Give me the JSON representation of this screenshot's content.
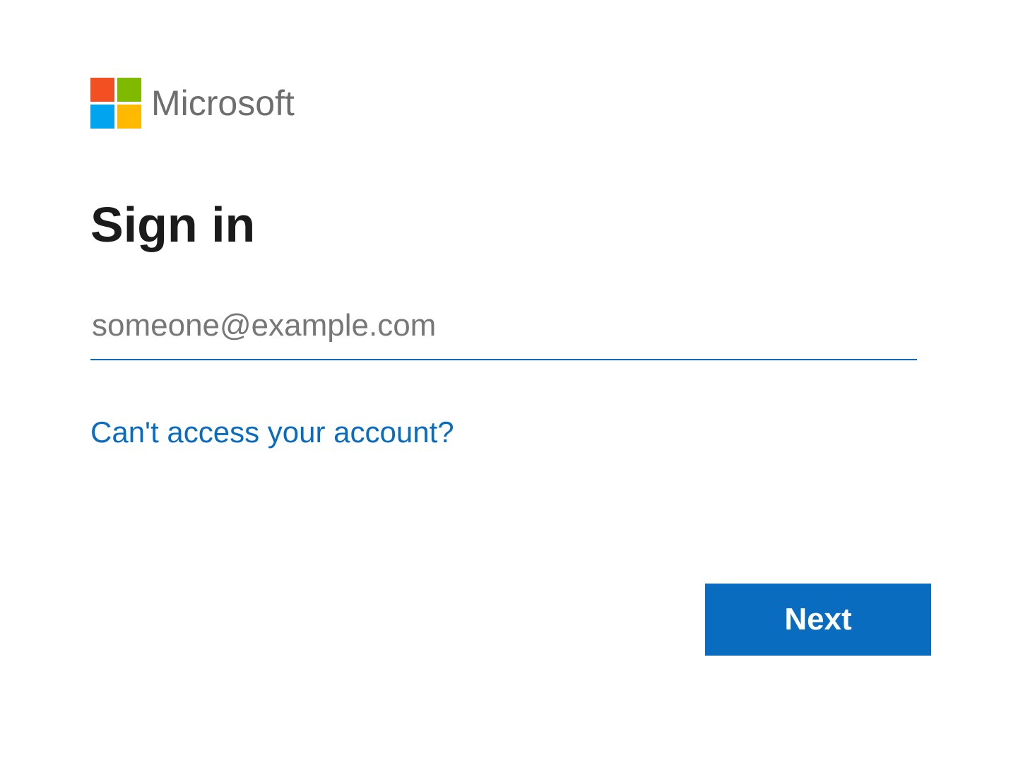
{
  "brand": {
    "name": "Microsoft",
    "logo_colors": {
      "top_left": "#f25022",
      "top_right": "#7fba00",
      "bottom_left": "#00a4ef",
      "bottom_right": "#ffb900"
    }
  },
  "title": "Sign in",
  "email_field": {
    "placeholder": "someone@example.com",
    "value": ""
  },
  "help_link": {
    "label": "Can't access your account?"
  },
  "buttons": {
    "next": "Next"
  },
  "colors": {
    "accent": "#0a6cbf",
    "text": "#1b1b1b",
    "muted": "#6e6e6e"
  }
}
